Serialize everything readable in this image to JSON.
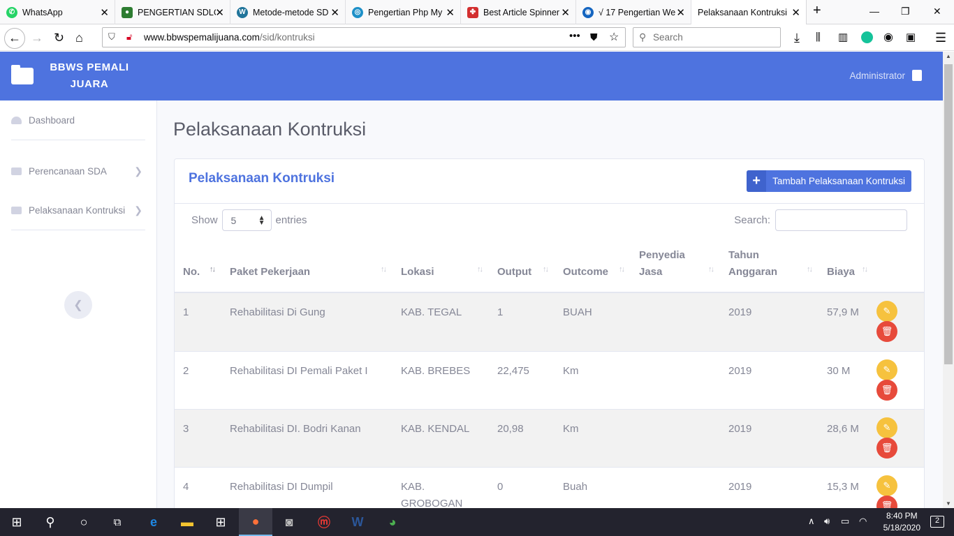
{
  "browser": {
    "tabs": [
      {
        "title": "WhatsApp",
        "icon": "whatsapp-icon",
        "color": "#25d366"
      },
      {
        "title": "PENGERTIAN SDLC (",
        "icon": "android-icon",
        "color": "#2e7d32"
      },
      {
        "title": "Metode-metode SD",
        "icon": "wordpress-icon",
        "color": "#21759b"
      },
      {
        "title": "Pengertian Php My",
        "icon": "globe-icon",
        "color": "#1e90c8"
      },
      {
        "title": "Best Article Spinner",
        "icon": "spinner-icon",
        "color": "#d32f2f"
      },
      {
        "title": "√ 17 Pengertian We",
        "icon": "world-icon",
        "color": "#1565c0"
      },
      {
        "title": "Pelaksanaan Kontruksi |",
        "icon": "",
        "color": ""
      }
    ],
    "url_host": "www.bbwspemalijuana.com",
    "url_path": "/sid/kontruksi",
    "search_placeholder": "Search"
  },
  "app": {
    "brand": "BBWS PEMALI JUARA",
    "user": "Administrator",
    "sidebar": [
      {
        "label": "Dashboard",
        "icon": "dashboard-icon"
      },
      {
        "label": "Perencanaan SDA",
        "icon": "folder-icon"
      },
      {
        "label": "Pelaksanaan Kontruksi",
        "icon": "folder-icon"
      }
    ],
    "page_title": "Pelaksanaan Kontruksi",
    "card_title": "Pelaksanaan Kontruksi",
    "add_button": "Tambah Pelaksanaan Kontruksi",
    "show_label": "Show",
    "entries_value": "5",
    "entries_label": "entries",
    "search_label": "Search:",
    "columns": [
      "No.",
      "Paket Pekerjaan",
      "Lokasi",
      "Output",
      "Outcome",
      "Penyedia Jasa",
      "Tahun Anggaran",
      "Biaya"
    ],
    "rows": [
      [
        "1",
        "Rehabilitasi Di Gung",
        "KAB. TEGAL",
        "1",
        "BUAH",
        "",
        "2019",
        "57,9 M"
      ],
      [
        "2",
        "Rehabilitasi DI Pemali Paket I",
        "KAB. BREBES",
        "22,475",
        "Km",
        "",
        "2019",
        "30 M"
      ],
      [
        "3",
        "Rehabilitasi DI. Bodri Kanan",
        "KAB. KENDAL",
        "20,98",
        "Km",
        "",
        "2019",
        "28,6 M"
      ],
      [
        "4",
        "Rehabilitasi DI Dumpil",
        "KAB. GROBOGAN",
        "0",
        "Buah",
        "",
        "2019",
        "15,3 M"
      ]
    ]
  },
  "taskbar": {
    "time": "8:40 PM",
    "date": "5/18/2020",
    "notifications": "2"
  },
  "colors": {
    "primary": "#4e73df",
    "warning": "#f6c23e",
    "danger": "#e74a3b"
  }
}
